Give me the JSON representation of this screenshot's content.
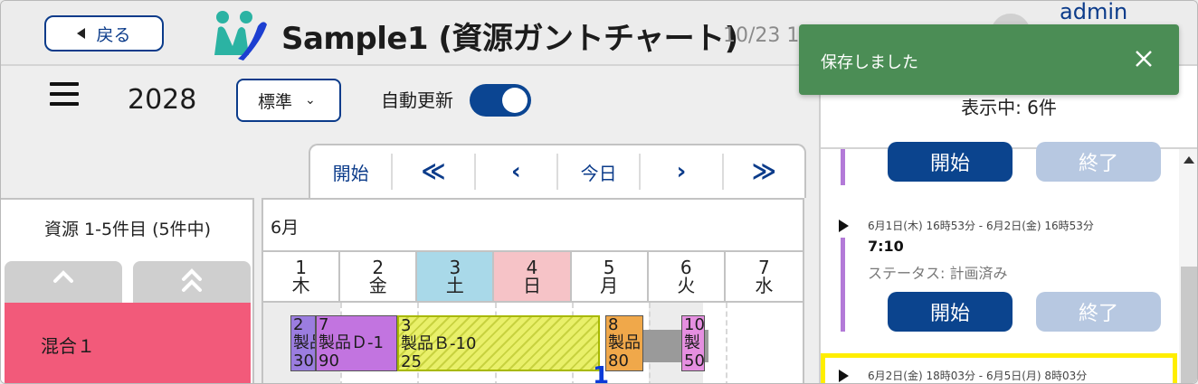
{
  "header": {
    "back_label": "戻る",
    "title": "Sample1 (資源ガントチャート)",
    "date_meta": "10/23 1",
    "user_name": "admin"
  },
  "toolbar": {
    "year": "2028",
    "view_select": "標準",
    "auto_update_label": "自動更新",
    "auto_update_on": true
  },
  "nav": {
    "start": "開始",
    "first": "≪",
    "prev": "‹",
    "today": "今日",
    "next": "›",
    "last": "≫"
  },
  "resources": {
    "title": "資源 1-5件目 (5件中)",
    "up_icon": "chevron-up-icon",
    "double_up_icon": "double-chevron-up-icon",
    "rows": [
      {
        "label": "混合１",
        "color": "#f25a7a"
      }
    ]
  },
  "gantt": {
    "month": "6月",
    "days": [
      {
        "num": "1",
        "dow": "木",
        "type": "weekday"
      },
      {
        "num": "2",
        "dow": "金",
        "type": "weekday"
      },
      {
        "num": "3",
        "dow": "土",
        "type": "sat"
      },
      {
        "num": "4",
        "dow": "日",
        "type": "sun"
      },
      {
        "num": "5",
        "dow": "月",
        "type": "weekday"
      },
      {
        "num": "6",
        "dow": "火",
        "type": "weekday"
      },
      {
        "num": "7",
        "dow": "水",
        "type": "weekday"
      }
    ],
    "bars": [
      {
        "lines": [
          "2",
          "製品",
          "30"
        ],
        "style": "b-purple"
      },
      {
        "lines": [
          "7",
          "製品Ｄ-1",
          "90"
        ],
        "style": "b-violet"
      },
      {
        "lines": [
          "3",
          "製品Ｂ-10",
          "25"
        ],
        "style": "b-yellow"
      },
      {
        "lines": [
          "8",
          "製品",
          "80"
        ],
        "style": "b-orange"
      },
      {
        "lines": [
          "10",
          "製",
          "50"
        ],
        "style": "b-pink"
      }
    ],
    "marker_label": "1"
  },
  "panel": {
    "showing": "表示中: 6件",
    "tasks": [
      {
        "start_label": "開始",
        "end_label": "終了"
      },
      {
        "date": "6月1日(木) 16時53分 - 6月2日(金) 16時53分",
        "time": "7:10",
        "status": "ステータス: 計画済み",
        "start_label": "開始",
        "end_label": "終了"
      },
      {
        "date": "6月2日(金) 18時03分 - 6月5日(月) 8時03分"
      }
    ]
  },
  "toast": {
    "message": "保存しました"
  },
  "colors": {
    "primary": "#0b448e",
    "toast": "#4b8d55",
    "highlight": "#ffee00"
  }
}
